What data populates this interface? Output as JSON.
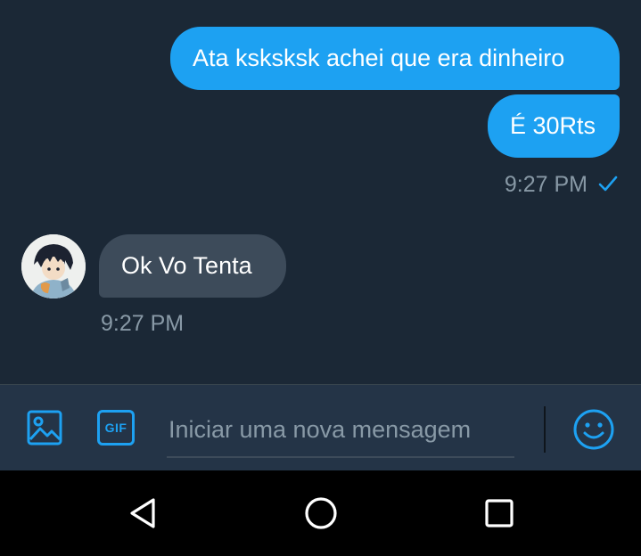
{
  "conversation": {
    "messages": [
      {
        "direction": "sent",
        "text": "Ata ksksksk achei que era dinheiro"
      },
      {
        "direction": "sent",
        "text": "É 30Rts"
      },
      {
        "direction": "received",
        "text": "Ok Vo Tenta"
      }
    ],
    "sent_timestamp": "9:27 PM",
    "sent_status_icon": "checkmark-icon",
    "received_timestamp": "9:27 PM",
    "avatar_icon": "contact-avatar"
  },
  "composer": {
    "placeholder": "Iniciar uma nova mensagem",
    "value": "",
    "gif_label": "GIF",
    "media_icon": "image-icon",
    "emoji_icon": "emoji-icon"
  },
  "nav_bar": {
    "back_icon": "triangle-back-icon",
    "home_icon": "circle-home-icon",
    "recent_icon": "square-recent-apps-icon"
  },
  "colors": {
    "background": "#1b2836",
    "composer_background": "#243447",
    "accent": "#1da1f2",
    "received_bubble": "#3d4b5a",
    "muted_text": "#8899a6",
    "nav_background": "#000000"
  }
}
